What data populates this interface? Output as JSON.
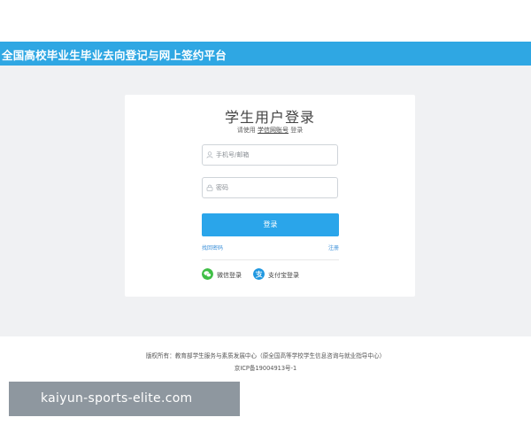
{
  "header": {
    "title": "全国高校毕业生毕业去向登记与网上签约平台",
    "bg_color": "#2fa7e3"
  },
  "login": {
    "title": "学生用户登录",
    "subtitle_prefix": "请使用",
    "subtitle_link": "学信网账号",
    "subtitle_suffix": "登录",
    "username_placeholder": "手机号/邮箱",
    "password_placeholder": "密码",
    "submit_label": "登录",
    "forgot_label": "找回密码",
    "register_label": "注册",
    "button_color": "#2aa5ea",
    "social": [
      {
        "label": "微信登录",
        "icon": "wechat-icon",
        "color": "#3fbe46"
      },
      {
        "label": "支付宝登录",
        "icon": "alipay-icon",
        "color": "#1e97e0"
      }
    ]
  },
  "footer": {
    "copyright": "版权所有：教育部学生服务与素质发展中心（原全国高等学校学生信息咨询与就业指导中心）",
    "icp": "京ICP备19004913号-1"
  },
  "overlay": {
    "text": "kaiyun-sports-elite.com"
  }
}
